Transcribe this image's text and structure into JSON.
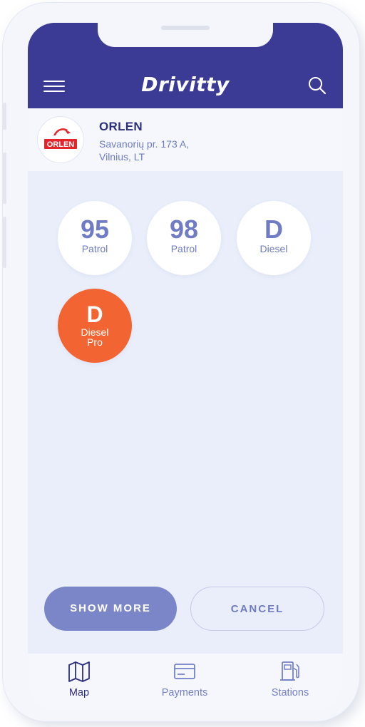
{
  "app": {
    "title": "Drivitty"
  },
  "station": {
    "brand_logo_text": "ORLEN",
    "name": "ORLEN",
    "address_line1": "Savanorių pr. 173 A,",
    "address_line2": "Vilnius, LT"
  },
  "fuels": [
    {
      "code": "95",
      "name": "Patrol",
      "selected": false
    },
    {
      "code": "98",
      "name": "Patrol",
      "selected": false
    },
    {
      "code": "D",
      "name": "Diesel",
      "selected": false
    },
    {
      "code": "D",
      "name_line1": "Diesel",
      "name_line2": "Pro",
      "selected": true
    }
  ],
  "actions": {
    "show_more": "SHOW MORE",
    "cancel": "CANCEL"
  },
  "tabs": [
    {
      "label": "Map",
      "icon": "map-icon",
      "active": true
    },
    {
      "label": "Payments",
      "icon": "credit-card-icon",
      "active": false
    },
    {
      "label": "Stations",
      "icon": "fuel-pump-icon",
      "active": false
    }
  ],
  "colors": {
    "header": "#3b3b96",
    "accent": "#f26432",
    "primary_button": "#7b86c8",
    "text_primary": "#2d2f7c",
    "text_secondary": "#6f7bc4"
  }
}
